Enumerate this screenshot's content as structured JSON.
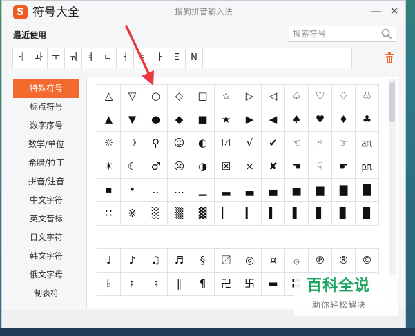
{
  "app": {
    "logo_letter": "S",
    "title": "符号大全",
    "window_title": "搜狗拼音输入法",
    "minimize": "—",
    "close": "✕"
  },
  "recent": {
    "label": "最近使用",
    "search_placeholder": "搜索符号",
    "symbols": [
      "ㅔ",
      "ㅘ",
      "ㅜ",
      "ㅝ",
      "ㅕ",
      "ㄴ",
      "ㅓ",
      "ㅑ",
      "ㅏ",
      "Ξ",
      "N"
    ]
  },
  "categories": [
    "特殊符号",
    "标点符号",
    "数字序号",
    "数学/单位",
    "希腊/拉丁",
    "拼音/注音",
    "中文字符",
    "英文音标",
    "日文字符",
    "韩文字符",
    "俄文字母",
    "制表符"
  ],
  "active_category": "特殊符号",
  "special_symbols": [
    "△",
    "▽",
    "○",
    "◇",
    "□",
    "☆",
    "▷",
    "◁",
    "♤",
    "♡",
    "♢",
    "♧",
    "▲",
    "▼",
    "●",
    "◆",
    "■",
    "★",
    "▶",
    "◀",
    "♠",
    "♥",
    "♦",
    "♣",
    "☼",
    "☽",
    "♀",
    "☺",
    "◐",
    "☑",
    "√",
    "✔",
    "☜",
    "☝",
    "☞",
    "㏂",
    "☀",
    "☾",
    "♂",
    "☹",
    "◑",
    "☒",
    "×",
    "✘",
    "☚",
    "☟",
    "☛",
    "㏘",
    "▪",
    "•",
    "‥",
    "…",
    "▁",
    "▂",
    "▃",
    "▄",
    "▅",
    "▆",
    "▇",
    "█",
    "∷",
    "※",
    "░",
    "▒",
    "▓",
    "▏",
    "▎",
    "▍",
    "▌",
    "▋",
    "▊",
    "▉"
  ],
  "more_symbols": [
    "♩",
    "♪",
    "♫",
    "♬",
    "§",
    "〼",
    "◎",
    "¤",
    "۞",
    "℗",
    "®",
    "©",
    "♭",
    "♯",
    "♮",
    "‖",
    "¶",
    "卍",
    "卐",
    "▬",
    "〓",
    "℡",
    "™",
    "㈱"
  ],
  "watermark": {
    "title": "百科全说",
    "subtitle": "助你轻松解决"
  },
  "colors": {
    "accent": "#f26a2e",
    "annotation_arrow": "#e8383d",
    "watermark_green": "#1aa260"
  }
}
